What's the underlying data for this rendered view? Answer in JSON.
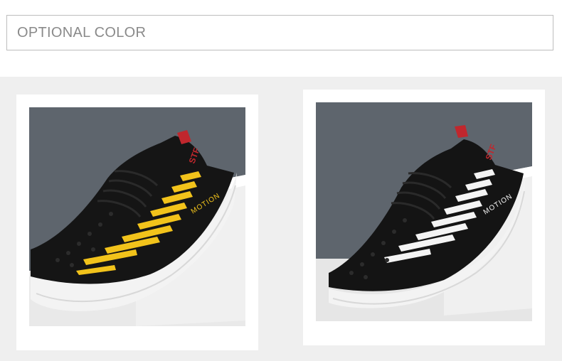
{
  "header": {
    "title": "OPTIONAL COLOR"
  },
  "products": [
    {
      "color_name": "yellow",
      "stripe_color": "#f2c31b",
      "logo_text": "MOTION",
      "brand_text": "STF"
    },
    {
      "color_name": "white",
      "stripe_color": "#f4f4f4",
      "logo_text": "MOTION",
      "brand_text": "STF"
    }
  ],
  "colors": {
    "background": "#efefef",
    "wall": "#5d646c",
    "sole": "#f2f2f2",
    "upper": "#141414",
    "accent_red": "#c0272d"
  }
}
